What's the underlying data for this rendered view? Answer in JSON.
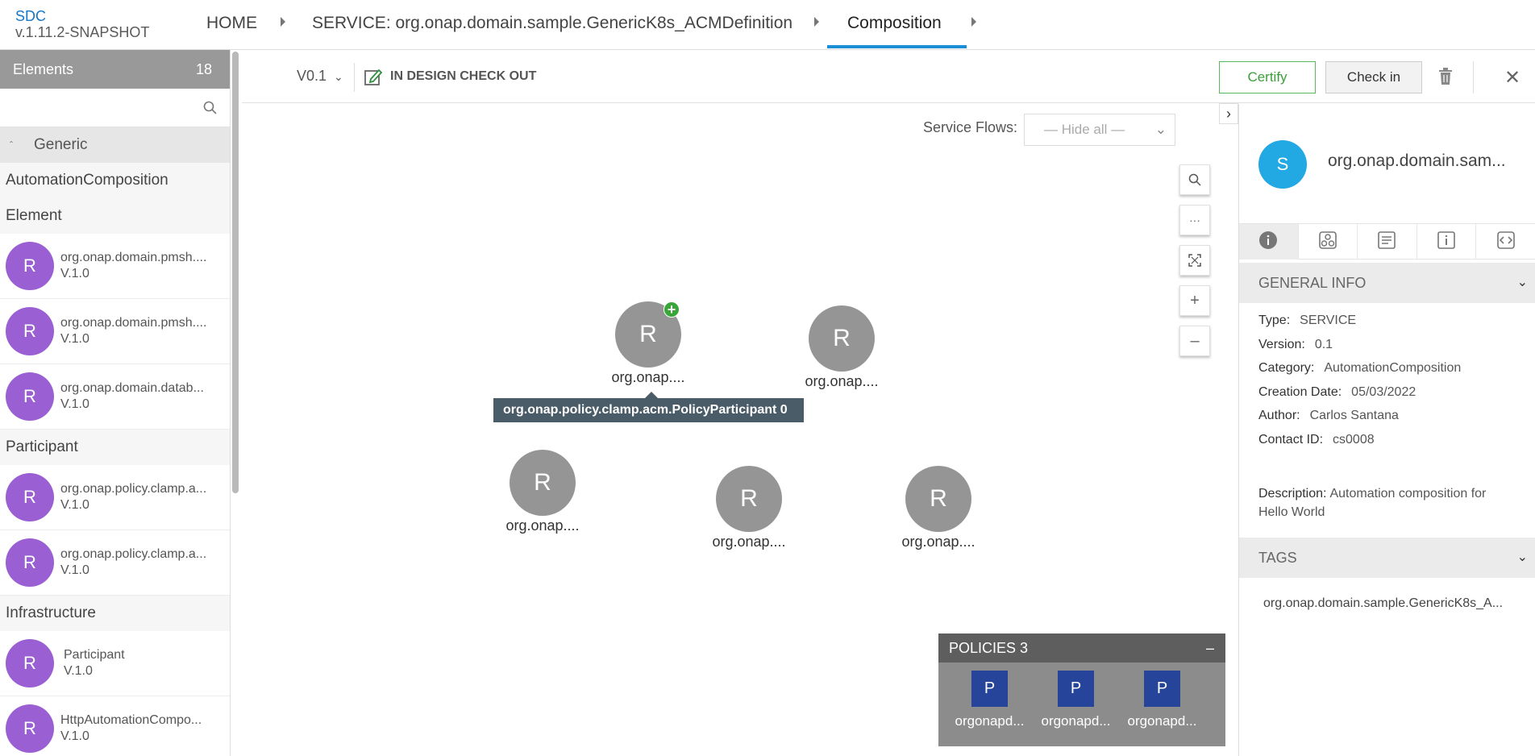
{
  "brand": {
    "name": "SDC",
    "version": "v.1.11.2-SNAPSHOT"
  },
  "breadcrumb": {
    "home": "HOME",
    "service": "SERVICE: org.onap.domain.sample.GenericK8s_ACMDefinition",
    "current": "Composition"
  },
  "palette": {
    "title": "Elements",
    "count": "18",
    "search_placeholder": "",
    "group": "Generic",
    "categories": {
      "automation": "AutomationComposition",
      "element": "Element",
      "participant": "Participant",
      "infrastructure": "Infrastructure"
    },
    "element_items": [
      {
        "avatar": "R",
        "name": "org.onap.domain.pmsh....",
        "version": "V.1.0"
      },
      {
        "avatar": "R",
        "name": "org.onap.domain.pmsh....",
        "version": "V.1.0"
      },
      {
        "avatar": "R",
        "name": "org.onap.domain.datab...",
        "version": "V.1.0"
      }
    ],
    "participant_items": [
      {
        "avatar": "R",
        "name": "org.onap.policy.clamp.a...",
        "version": "V.1.0"
      },
      {
        "avatar": "R",
        "name": "org.onap.policy.clamp.a...",
        "version": "V.1.0"
      }
    ],
    "infrastructure_items": [
      {
        "avatar": "R",
        "name": "Participant",
        "version": "V.1.0"
      },
      {
        "avatar": "R",
        "name": "HttpAutomationCompo...",
        "version": "V.1.0"
      }
    ]
  },
  "actionbar": {
    "version": "V0.1",
    "status": "IN DESIGN CHECK OUT",
    "certify": "Certify",
    "checkin": "Check in"
  },
  "canvas": {
    "service_flows_label": "Service Flows:",
    "service_flows_value": "— Hide all —",
    "tooltip": "org.onap.policy.clamp.acm.PolicyParticipant 0",
    "nodes": [
      {
        "letter": "R",
        "label": "org.onap...."
      },
      {
        "letter": "R",
        "label": "org.onap...."
      },
      {
        "letter": "R",
        "label": "org.onap...."
      },
      {
        "letter": "R",
        "label": "org.onap...."
      },
      {
        "letter": "R",
        "label": "org.onap...."
      }
    ],
    "policies": {
      "title": "POLICIES 3",
      "collapse": "–",
      "items": [
        {
          "letter": "P",
          "label": "orgonapd..."
        },
        {
          "letter": "P",
          "label": "orgonapd..."
        },
        {
          "letter": "P",
          "label": "orgonapd..."
        }
      ]
    }
  },
  "rpanel": {
    "avatar": "S",
    "name": "org.onap.domain.sam...",
    "general_info_title": "GENERAL INFO",
    "info": {
      "type_label": "Type:",
      "type": "SERVICE",
      "version_label": "Version:",
      "version": "0.1",
      "category_label": "Category:",
      "category": "AutomationComposition",
      "creation_label": "Creation Date:",
      "creation": "05/03/2022",
      "author_label": "Author:",
      "author": "Carlos Santana",
      "contact_label": "Contact ID:",
      "contact": "cs0008",
      "description_label": "Description:",
      "description_line1": "Automation composition for",
      "description_line2": "Hello World"
    },
    "tags_title": "TAGS",
    "tag": "org.onap.domain.sample.GenericK8s_A..."
  },
  "colors": {
    "accent": "#1b8ed6",
    "element_avatar": "#9a60d3",
    "node": "#959595",
    "service_avatar": "#22a8e3",
    "policy": "#26449a",
    "certify": "#3a9f3a"
  },
  "icons": [
    "search-icon",
    "checkout-icon",
    "trash-icon",
    "close-icon",
    "zoom-search-icon",
    "more-icon",
    "fit-icon",
    "zoom-in-icon",
    "zoom-out-icon",
    "info-icon",
    "composition-icon",
    "list-icon",
    "properties-icon",
    "code-icon"
  ]
}
